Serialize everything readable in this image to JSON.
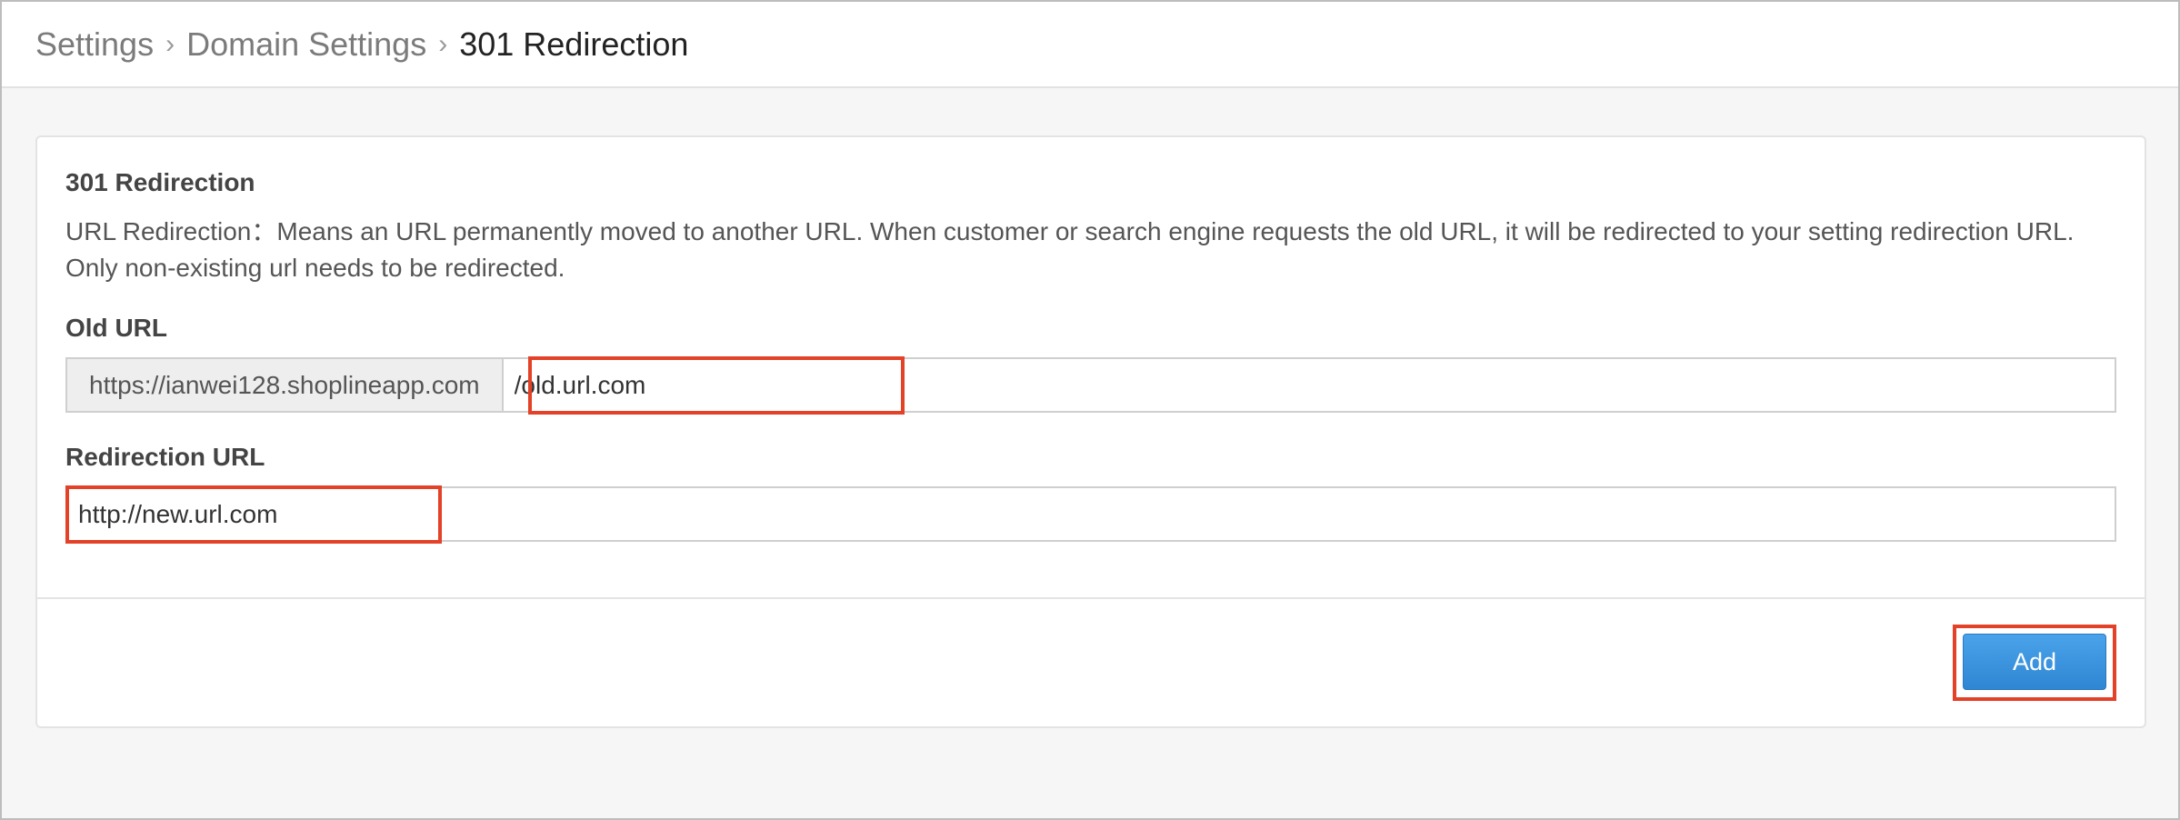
{
  "breadcrumb": {
    "items": [
      "Settings",
      "Domain Settings"
    ],
    "current": "301 Redirection",
    "separator": "›"
  },
  "card": {
    "title": "301 Redirection",
    "description": "URL Redirection：Means an URL permanently moved to another URL. When customer or search engine requests the old URL, it will be redirected to your setting redirection URL. Only non-existing url needs to be redirected."
  },
  "old_url": {
    "label": "Old URL",
    "prefix": "https://ianwei128.shoplineapp.com",
    "value": "/old.url.com"
  },
  "redirection_url": {
    "label": "Redirection URL",
    "value": "http://new.url.com"
  },
  "actions": {
    "add_label": "Add"
  },
  "colors": {
    "highlight": "#e34128",
    "button": "#3a93de",
    "page_background": "#f6f6f6"
  }
}
